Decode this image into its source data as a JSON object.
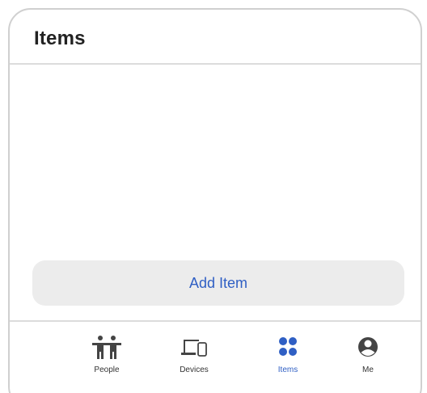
{
  "header": {
    "title": "Items"
  },
  "main": {
    "add_item_label": "Add Item"
  },
  "tabbar": {
    "tabs": [
      {
        "label": "People",
        "icon": "people-icon",
        "active": false
      },
      {
        "label": "Devices",
        "icon": "devices-icon",
        "active": false
      },
      {
        "label": "Items",
        "icon": "items-icon",
        "active": true
      },
      {
        "label": "Me",
        "icon": "profile-icon",
        "active": false
      }
    ]
  },
  "colors": {
    "accent": "#2f5fc4",
    "button_bg": "#ececec",
    "divider": "#dcdcdc",
    "icon_dark": "#444444"
  }
}
